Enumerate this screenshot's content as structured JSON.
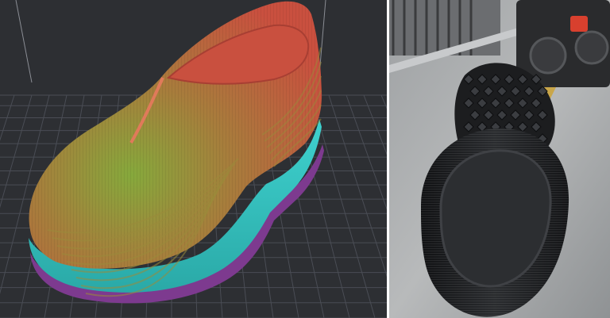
{
  "panels": [
    {
      "id": "slicer-preview",
      "subject": "shoe-layer-preview",
      "colors": {
        "background": "#2d2f33",
        "grid": "#4a4d55",
        "upper_outer": "#c9503f",
        "upper_inner": "#7aa23a",
        "midsole": "#35c7c4",
        "skirt": "#7d3a8f",
        "groove": "#9a8a3a"
      }
    },
    {
      "id": "printer-photo",
      "subject": "printed-shoe-on-bed",
      "colors": {
        "bed": "#aeb0b1",
        "print": "#1c1d1f",
        "toolhead": "#2a2b2d",
        "accent": "#d8402e",
        "rail": "#c8cacc"
      }
    }
  ],
  "divider_color": "#ffffff"
}
